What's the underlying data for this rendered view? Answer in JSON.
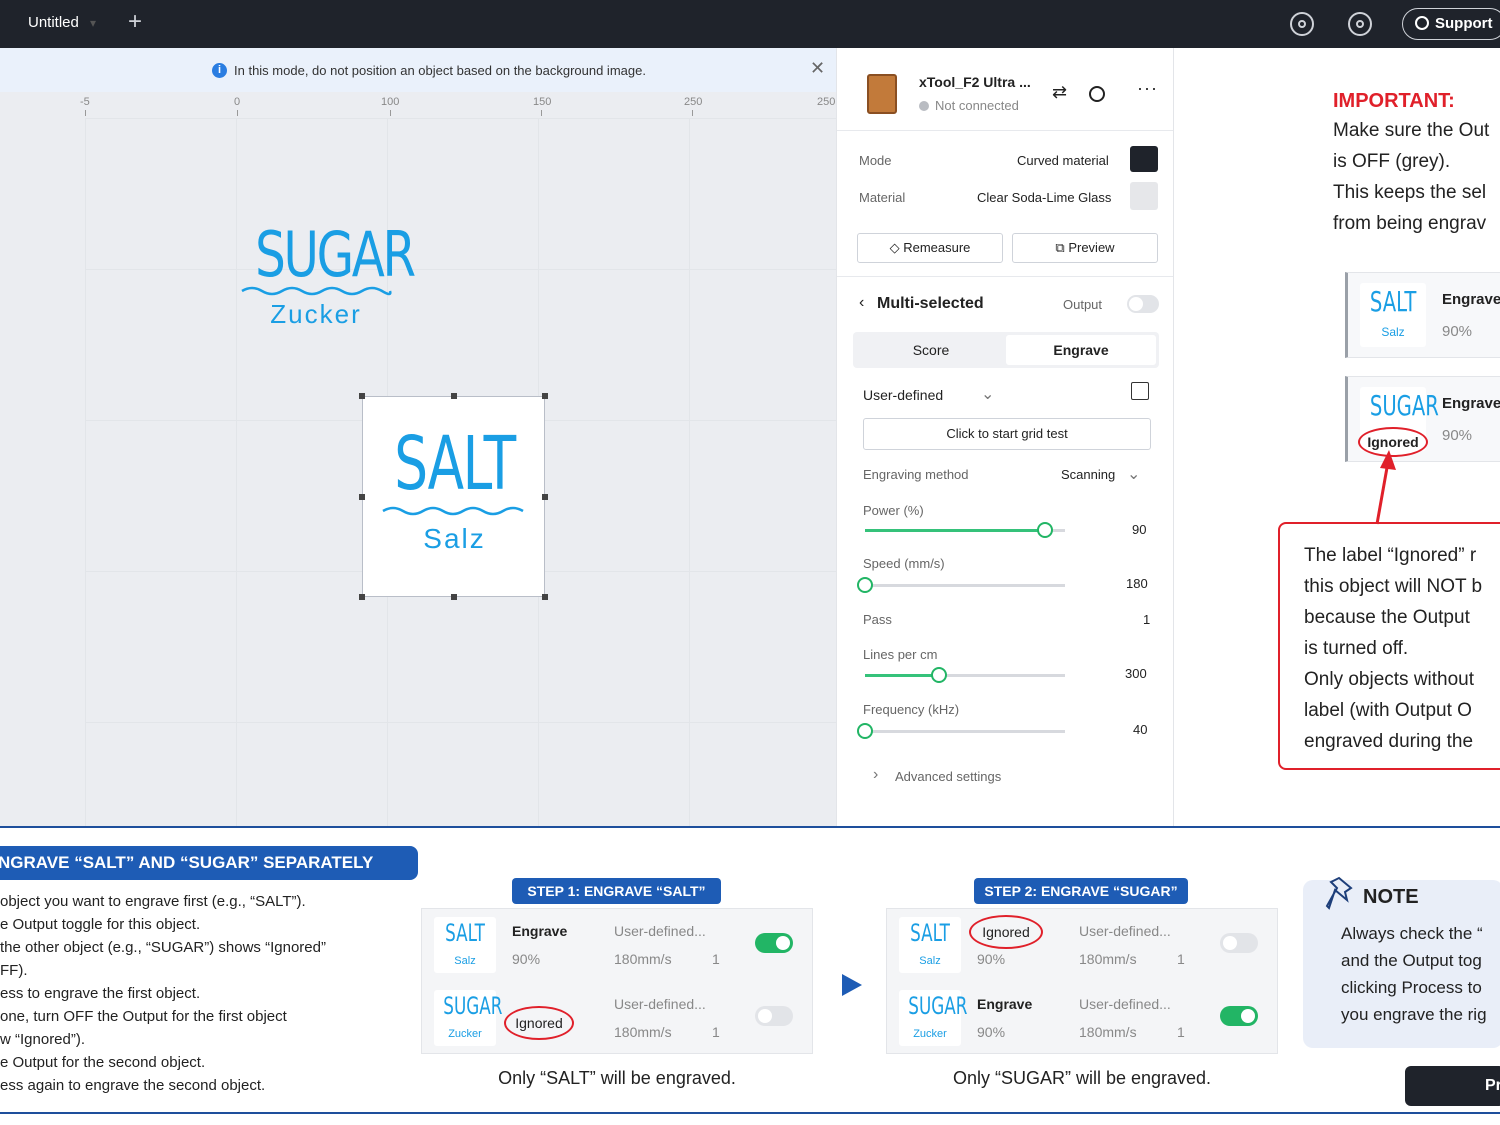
{
  "topbar": {
    "tab_title": "Untitled",
    "support_label": "Support"
  },
  "canvas": {
    "notice": "In this mode, do not position an object based on the background image.",
    "ruler": [
      "-5",
      "0",
      "100",
      "150",
      "250",
      "250"
    ],
    "sugar": {
      "word": "SUGAR",
      "sub": "Zucker"
    },
    "salt": {
      "word": "SALT",
      "sub": "Salz"
    }
  },
  "panel": {
    "device_name": "xTool_F2 Ultra ...",
    "device_status": "Not connected",
    "mode_label": "Mode",
    "mode_value": "Curved material",
    "material_label": "Material",
    "material_value": "Clear Soda-Lime Glass",
    "remeasure": "Remeasure",
    "preview": "Preview",
    "multi_selected": "Multi-selected",
    "output_label": "Output",
    "tab_score": "Score",
    "tab_engrave": "Engrave",
    "preset": "User-defined",
    "grid_test": "Click to start grid test",
    "method_label": "Engraving method",
    "method_value": "Scanning",
    "power_label": "Power (%)",
    "power_value": "90",
    "speed_label": "Speed (mm/s)",
    "speed_value": "180",
    "pass_label": "Pass",
    "pass_value": "1",
    "lines_label": "Lines per cm",
    "lines_value": "300",
    "freq_label": "Frequency (kHz)",
    "freq_value": "40",
    "advanced": "Advanced settings",
    "slider_levels": {
      "power": 0.9,
      "speed": 0.0,
      "lines": 0.37,
      "frequency": 0.0
    }
  },
  "right_note": {
    "title": "IMPORTANT:",
    "lines": [
      "Make sure the Out",
      "is OFF (grey).",
      "This keeps the sel",
      "from being engrav"
    ],
    "card1": {
      "t1": "SALT",
      "t2": "Salz",
      "label": "Engrave",
      "pct": "90%"
    },
    "card2": {
      "t1": "SUGAR",
      "t2": "Ignored",
      "label": "Engrave",
      "pct": "90%"
    },
    "callout": [
      "The label “Ignored” r",
      "this object will NOT b",
      "because the Output",
      "is turned off.",
      "Only objects without",
      "label (with Output O",
      "engraved during the"
    ]
  },
  "bottom": {
    "banner": "NGRAVE “SALT” AND “SUGAR” SEPARATELY",
    "steps": [
      "object you want to engrave first (e.g., “SALT”).",
      "e Output toggle for this object.",
      "the other object (e.g., “SUGAR”) shows “Ignored”",
      "FF).",
      "ess to engrave the first object.",
      "one, turn OFF the Output for the first object",
      "w “Ignored”).",
      "e Output for the second object.",
      "ess again to engrave the second object."
    ],
    "step1": {
      "title": "STEP 1: ENGRAVE “SALT”",
      "rows": [
        {
          "t1": "SALT",
          "t2": "Salz",
          "label": "Engrave",
          "pct": "90%",
          "ud": "User-defined...",
          "speed": "180mm/s",
          "pass": "1"
        },
        {
          "t1": "SUGAR",
          "t2": "Zucker",
          "label": "Ignored",
          "pct": "",
          "ud": "User-defined...",
          "speed": "180mm/s",
          "pass": "1"
        }
      ],
      "caption": "Only “SALT” will be engraved."
    },
    "step2": {
      "title": "STEP 2: ENGRAVE “SUGAR”",
      "rows": [
        {
          "t1": "SALT",
          "t2": "Salz",
          "label": "Ignored",
          "pct": "90%",
          "ud": "User-defined...",
          "speed": "180mm/s",
          "pass": "1"
        },
        {
          "t1": "SUGAR",
          "t2": "Zucker",
          "label": "Engrave",
          "pct": "90%",
          "ud": "User-defined...",
          "speed": "180mm/s",
          "pass": "1"
        }
      ],
      "caption": "Only “SUGAR” will be engraved."
    },
    "note_title": "NOTE",
    "note_lines": [
      "Always check the “",
      "and the Output tog",
      "clicking Process to",
      "you engrave the rig"
    ],
    "process": "Pr"
  },
  "colors": {
    "accent_blue": "#1e5cb5",
    "brand_cyan": "#1a9ee4",
    "warning_red": "#e0202a",
    "toggle_on": "#22b565"
  }
}
